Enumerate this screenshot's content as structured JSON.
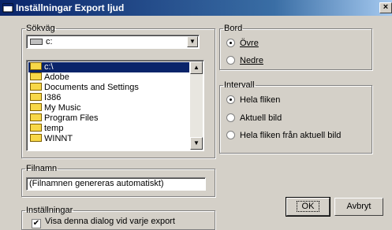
{
  "window": {
    "title": "Inställningar Export ljud",
    "close_glyph": "×"
  },
  "sokvag": {
    "legend": "Sökväg",
    "drive_value": "c:",
    "folders": [
      {
        "label": "c:\\",
        "selected": true
      },
      {
        "label": "Adobe"
      },
      {
        "label": "Documents and Settings"
      },
      {
        "label": "I386"
      },
      {
        "label": "My Music"
      },
      {
        "label": "Program Files"
      },
      {
        "label": "temp"
      },
      {
        "label": "WINNT"
      }
    ]
  },
  "filnamn": {
    "legend": "Filnamn",
    "value": "(Filnamnen genereras automatiskt)"
  },
  "installningar": {
    "legend": "Inställningar",
    "checkbox_label": "Visa denna dialog vid varje export",
    "checked": true
  },
  "bord": {
    "legend": "Bord",
    "options": [
      {
        "label": "Övre",
        "selected": true
      },
      {
        "label": "Nedre",
        "selected": false
      }
    ]
  },
  "intervall": {
    "legend": "Intervall",
    "options": [
      {
        "label": "Hela fliken",
        "selected": true
      },
      {
        "label": "Aktuell bild",
        "selected": false
      },
      {
        "label": "Hela fliken från aktuell bild",
        "selected": false
      }
    ]
  },
  "buttons": {
    "ok": "OK",
    "cancel": "Avbryt"
  },
  "icons": {
    "close": "close-icon",
    "window": "app-icon",
    "drive": "drive-icon",
    "folder": "folder-icon"
  }
}
